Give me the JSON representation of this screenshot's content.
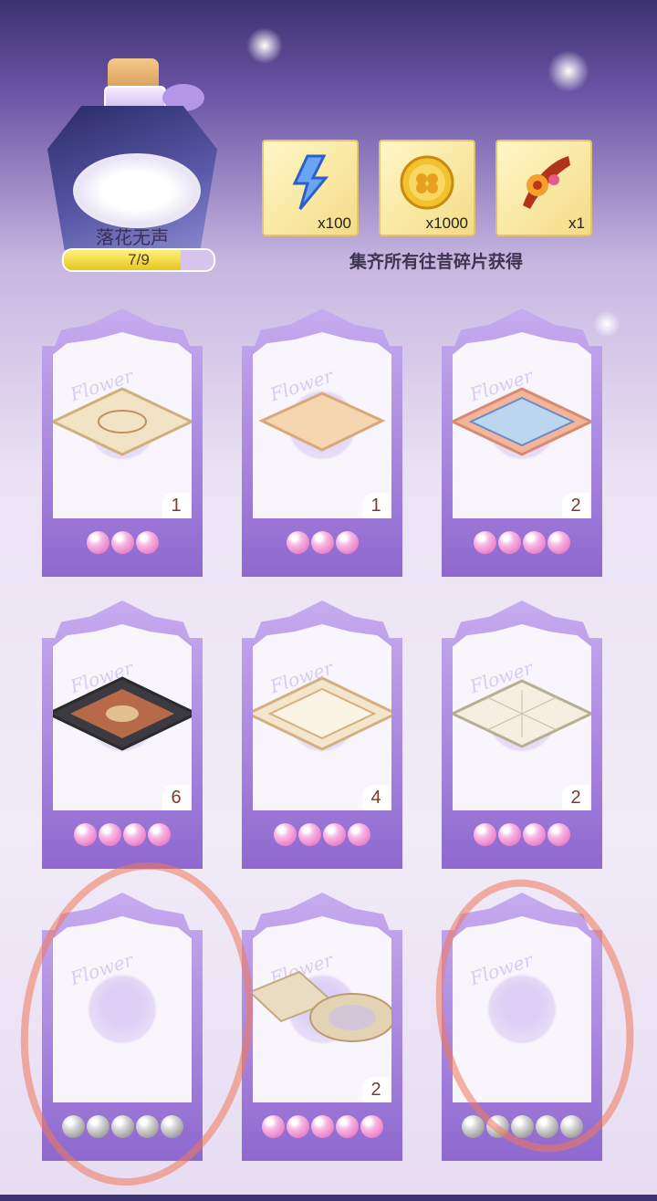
{
  "collection": {
    "name": "落花无声",
    "progress": "7/9",
    "progress_fraction": 0.78
  },
  "rewards": [
    {
      "icon": "lightning-icon",
      "quantity": "x100"
    },
    {
      "icon": "gold-coin-icon",
      "quantity": "x1000"
    },
    {
      "icon": "flower-hairpin-icon",
      "quantity": "x1"
    }
  ],
  "caption": "集齐所有往昔碎片获得",
  "cards": [
    {
      "name": "ornate-beige-rug",
      "count": "1",
      "pearls": [
        "pink",
        "pink",
        "pink"
      ]
    },
    {
      "name": "plain-peach-rug",
      "count": "1",
      "pearls": [
        "pink",
        "pink",
        "pink"
      ]
    },
    {
      "name": "blue-tile-rug",
      "count": "2",
      "pearls": [
        "pink",
        "pink",
        "pink",
        "pink"
      ]
    },
    {
      "name": "persian-rug",
      "count": "6",
      "pearls": [
        "pink",
        "pink",
        "pink",
        "pink"
      ]
    },
    {
      "name": "scroll-border-rug",
      "count": "4",
      "pearls": [
        "pink",
        "pink",
        "pink",
        "pink"
      ]
    },
    {
      "name": "grid-pattern-rug",
      "count": "2",
      "pearls": [
        "pink",
        "pink",
        "pink",
        "pink"
      ]
    },
    {
      "name": "empty-slot-1",
      "count": "",
      "pearls": [
        "grey",
        "grey",
        "grey",
        "grey",
        "grey"
      ]
    },
    {
      "name": "stone-path-rug",
      "count": "2",
      "pearls": [
        "pink",
        "pink",
        "pink",
        "pink",
        "pink"
      ]
    },
    {
      "name": "empty-slot-2",
      "count": "",
      "pearls": [
        "grey",
        "grey",
        "grey",
        "grey",
        "grey"
      ]
    }
  ]
}
